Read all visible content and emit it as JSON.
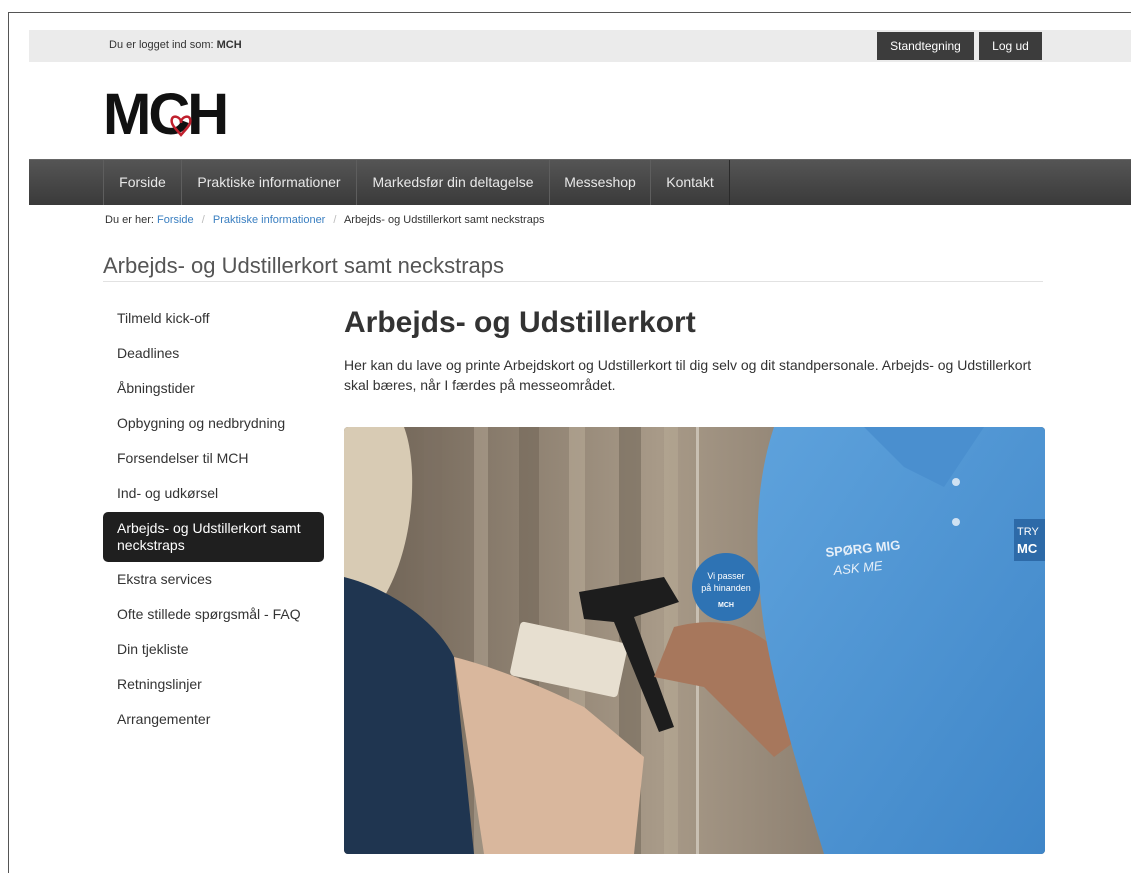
{
  "topbar": {
    "login_prefix": "Du er logget ind som:",
    "user": "MCH",
    "stand_button": "Standtegning",
    "logout_button": "Log ud"
  },
  "logo": {
    "text": "MCH",
    "accent_color": "#c0202d"
  },
  "nav": {
    "items": [
      {
        "label": "Forside"
      },
      {
        "label": "Praktiske informationer"
      },
      {
        "label": "Markedsfør din deltagelse"
      },
      {
        "label": "Messeshop"
      },
      {
        "label": "Kontakt"
      }
    ]
  },
  "breadcrumb": {
    "prefix": "Du er her:",
    "items": [
      "Forside",
      "Praktiske informationer",
      "Arbejds- og Udstillerkort samt neckstraps"
    ]
  },
  "page": {
    "title": "Arbejds- og Udstillerkort samt neckstraps"
  },
  "sidebar": {
    "items": [
      {
        "label": "Tilmeld kick-off"
      },
      {
        "label": "Deadlines"
      },
      {
        "label": "Åbningstider"
      },
      {
        "label": "Opbygning og nedbrydning"
      },
      {
        "label": "Forsendelser til MCH"
      },
      {
        "label": "Ind- og udkørsel"
      },
      {
        "label": "Arbejds- og Udstillerkort samt neckstraps",
        "active": true
      },
      {
        "label": "Ekstra services"
      },
      {
        "label": "Ofte stillede spørgsmål - FAQ"
      },
      {
        "label": "Din tjekliste"
      },
      {
        "label": "Retningslinjer"
      },
      {
        "label": "Arrangementer"
      }
    ]
  },
  "main": {
    "heading": "Arbejds- og Udstillerkort",
    "intro": "Her kan du lave og printe Arbejdskort og Udstillerkort til dig selv og dit standpersonale. Arbejds- og Udstillerkort skal bæres, når I færdes på messeområdet."
  },
  "photo": {
    "sticker_line1": "Vi passer",
    "sticker_line2": "på hinanden",
    "sticker_logo": "MCH",
    "shirt_line1": "SPØRG MIG",
    "shirt_line2": "ASK ME",
    "badge_text1": "TRY",
    "badge_text2": "MC"
  }
}
